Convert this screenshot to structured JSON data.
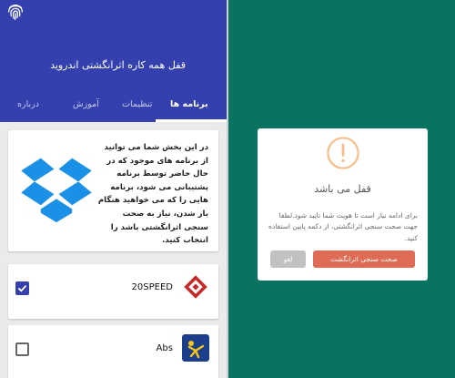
{
  "colors": {
    "primary": "#3340ae",
    "background_left": "#ebebeb",
    "background_right": "#077360",
    "confirm_button": "#dd6b55",
    "cancel_button": "#c1c1c1",
    "warning": "#f8bb86"
  },
  "appbar": {
    "icon": "fingerprint-icon",
    "title": "قفل همه کاره اثرانگشتی اندروید"
  },
  "tabs": [
    {
      "label": "برنامه ها",
      "active": true
    },
    {
      "label": "تنظیمات",
      "active": false
    },
    {
      "label": "آموزش",
      "active": false
    },
    {
      "label": "درباره",
      "active": false
    }
  ],
  "info_card": {
    "icon": "dropbox-icon",
    "text": "در این بخش شما می توانید از برنامه های موجود که در حال حاضر توسط برنامه پشتیبانی می شود، برنامه هایی را که می خواهید هنگام باز شدن، نیاز به صحت سنجی اثرانگشتی باشد را انتخاب کنید."
  },
  "apps": [
    {
      "name": "20SPEED",
      "checked": true,
      "icon": "speed-app-icon"
    },
    {
      "name": "Abs",
      "checked": false,
      "icon": "abs-app-icon"
    }
  ],
  "dialog": {
    "icon": "warning-icon",
    "title": "قفل می باشد",
    "message": "برای ادامه نیاز است تا هویت شما تایید شود.لطفا جهت صحت سنجی اثرانگشتی، از دکمه پایین استفاده کنید.",
    "confirm_label": "صحت سنجی اثرانگشت",
    "cancel_label": "لغو"
  }
}
